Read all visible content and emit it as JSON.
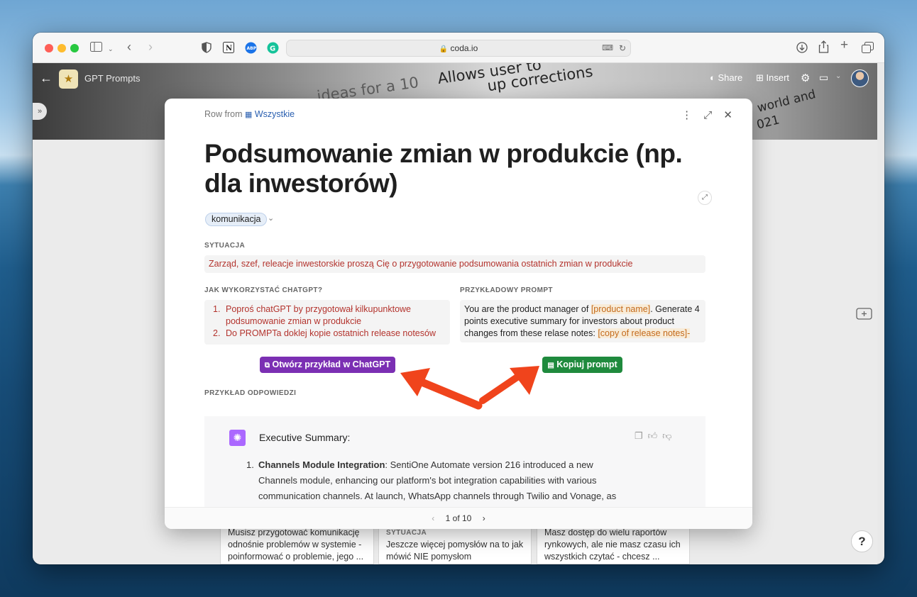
{
  "browser": {
    "url": "coda.io"
  },
  "doc_header": {
    "title": "GPT Prompts",
    "share_label": "Share",
    "insert_label": "Insert",
    "banner_texts": [
      "Allows user to",
      "up corrections",
      "ideas for a 10",
      "world and",
      "021"
    ]
  },
  "modal": {
    "row_from_prefix": "Row from",
    "row_from_table": "Wszystkie",
    "title": "Podsumowanie zmian w produkcie (np. dla inwestorów)",
    "tag": "komunikacja",
    "situation_label": "SYTUACJA",
    "situation_text": "Zarząd, szef, releacje inwestorskie proszą Cię o przygotowanie podsumowania ostatnich zmian w produkcie",
    "how_label": "JAK WYKORZYSTAĆ CHATGPT?",
    "how_steps": [
      {
        "num": "1.",
        "text": "Poproś chatGPT by przygotował kilkupunktowe podsumowanie zmian w produkcie"
      },
      {
        "num": "2.",
        "text": "Do PROMPTa doklej kopie ostatnich release notesów"
      }
    ],
    "prompt_label": "PRZYKŁADOWY PROMPT",
    "prompt_part1": "You are the product manager of ",
    "prompt_hl1": "[product name]",
    "prompt_part2": ". Generate 4 points executive summary for investors about product changes from these relase notes: ",
    "prompt_hl2": "[copy of release notes]-",
    "open_button": "Otwórz przykład w ChatGPT",
    "copy_button": "Kopiuj prompt",
    "answer_label": "PRZYKŁAD ODPOWIEDZI",
    "response": {
      "heading": "Executive Summary:",
      "item_num": "1.",
      "item_bold": "Channels Module Integration",
      "item_text": ": SentiOne Automate version 216 introduced a new Channels module, enhancing our platform's bot integration capabilities with various communication channels. At launch, WhatsApp channels through Twilio and Vonage, as"
    },
    "pager": "1 of 10"
  },
  "background_rows": [
    {
      "text": "Musisz przygotować komunikację odnośnie problemów w systemie - poinformować o problemie, jego ..."
    },
    {
      "label": "SYTUACJA",
      "text": "Jeszcze więcej pomysłów na to jak mówić NIE pomysłom"
    },
    {
      "text": "Masz dostęp do wielu raportów rynkowych, ale nie masz czasu ich wszystkich czytać - chcesz ..."
    }
  ],
  "help_label": "?",
  "colors": {
    "accent_purple": "#7b2fb3",
    "accent_green": "#1f8a3d",
    "arrow": "#f0441c",
    "situation_text": "#b3332d"
  }
}
